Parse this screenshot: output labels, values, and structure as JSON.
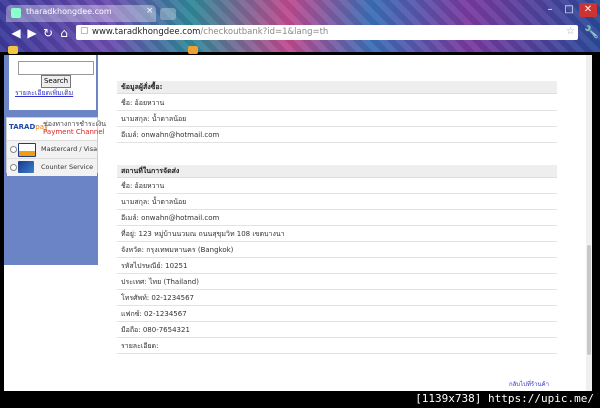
{
  "browser": {
    "tab_title": "tharadkhongdee.com",
    "close_glyph": "×",
    "url_main": "www.taradkhongdee.com",
    "url_rest": "/checkoutbank?id=1&lang=th",
    "win_min": "–",
    "win_max": "□",
    "win_close": "✕",
    "back": "◀",
    "forward": "▶",
    "reload": "↻",
    "home": "⌂",
    "star": "☆",
    "wrench": "🔧"
  },
  "sidebar": {
    "search_button": "Search",
    "more_link": "รายละเอียดเพิ่มเติม",
    "payment_logo_brand": "TARAD",
    "payment_logo_suffix": "pay",
    "payment_channel_th": "ช่องทางการชำระเงิน",
    "payment_channel_en": "Payment Channel",
    "methods": [
      {
        "label": "Mastercard  /  Visa",
        "icon": "visa-mastercard-icon"
      },
      {
        "label": "Counter  Service",
        "icon": "counter-service-icon"
      }
    ]
  },
  "orderer": {
    "heading": "ข้อมูลผู้สั่งซื้อ:",
    "rows": [
      "ชื่อ: อ้อยหวาน",
      "นามสกุล: น้ำตาลน้อย",
      "อีเมล์: onwahn@hotmail.com"
    ]
  },
  "shipping": {
    "heading": "สถานที่ในการจัดส่ง",
    "rows": [
      "ชื่อ: อ้อยหวาน",
      "นามสกุล: น้ำตาลน้อย",
      "อีเมล์: onwahn@hotmail.com",
      "ที่อยู่: 123 หมู่บ้านนวมณ ถนนสุขุมวิท 108 เขตบางนา",
      "จังหวัด: กรุงเทพมหานคร (Bangkok)",
      "รหัสไปรษณีย์: 10251",
      "ประเทศ: ไทย (Thailand)",
      "โทรศัพท์: 02-1234567",
      "แฟกซ์: 02-1234567",
      "มือถือ: 080-7654321",
      "รายละเอียด:"
    ]
  },
  "footer_link": "กลับไปที่ร้านค้า",
  "watermark": "[1139x738] https://upic.me/",
  "colors": {
    "sidebar_bg": "#6b84c6",
    "link": "#3333cc",
    "payment_channel": "#dd2222"
  }
}
